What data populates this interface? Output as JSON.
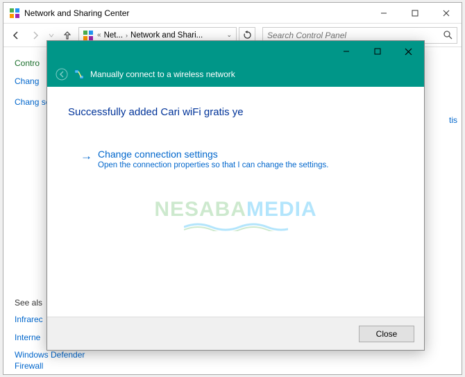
{
  "parent": {
    "title": "Network and Sharing Center",
    "breadcrumb": {
      "item1": "Net...",
      "item2": "Network and Shari..."
    },
    "search_placeholder": "Search Control Panel",
    "sidebar": {
      "heading": "Contro",
      "links": [
        "Chang",
        "Chang setting"
      ],
      "see_also_label": "See als",
      "see_also": [
        "Infrarec",
        "Interne",
        "Windows Defender Firewall"
      ]
    },
    "main_link_fragment": "tis"
  },
  "wizard": {
    "header_title": "Manually connect to a wireless network",
    "success_title": "Successfully added Cari wiFi gratis ye",
    "option": {
      "title": "Change connection settings",
      "desc": "Open the connection properties so that I can change the settings."
    },
    "close_label": "Close"
  },
  "watermark": {
    "part1": "NESABA",
    "part2": "MEDIA"
  }
}
